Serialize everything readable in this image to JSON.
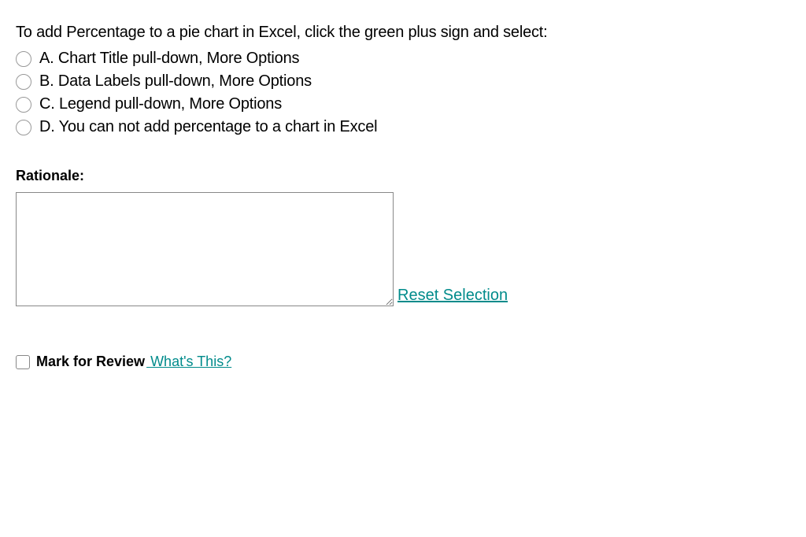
{
  "question": {
    "prompt": "To add Percentage to a pie chart in Excel, click the green plus sign and select:",
    "options": [
      {
        "label": "A. Chart Title pull-down, More Options"
      },
      {
        "label": "B. Data Labels pull-down, More Options"
      },
      {
        "label": "C. Legend pull-down, More Options"
      },
      {
        "label": "D. You can not add percentage to a chart in Excel"
      }
    ]
  },
  "rationale": {
    "label": "Rationale:"
  },
  "actions": {
    "reset_label": "Reset Selection"
  },
  "review": {
    "mark_label": "Mark for Review",
    "whats_this_label": " What's This?"
  }
}
